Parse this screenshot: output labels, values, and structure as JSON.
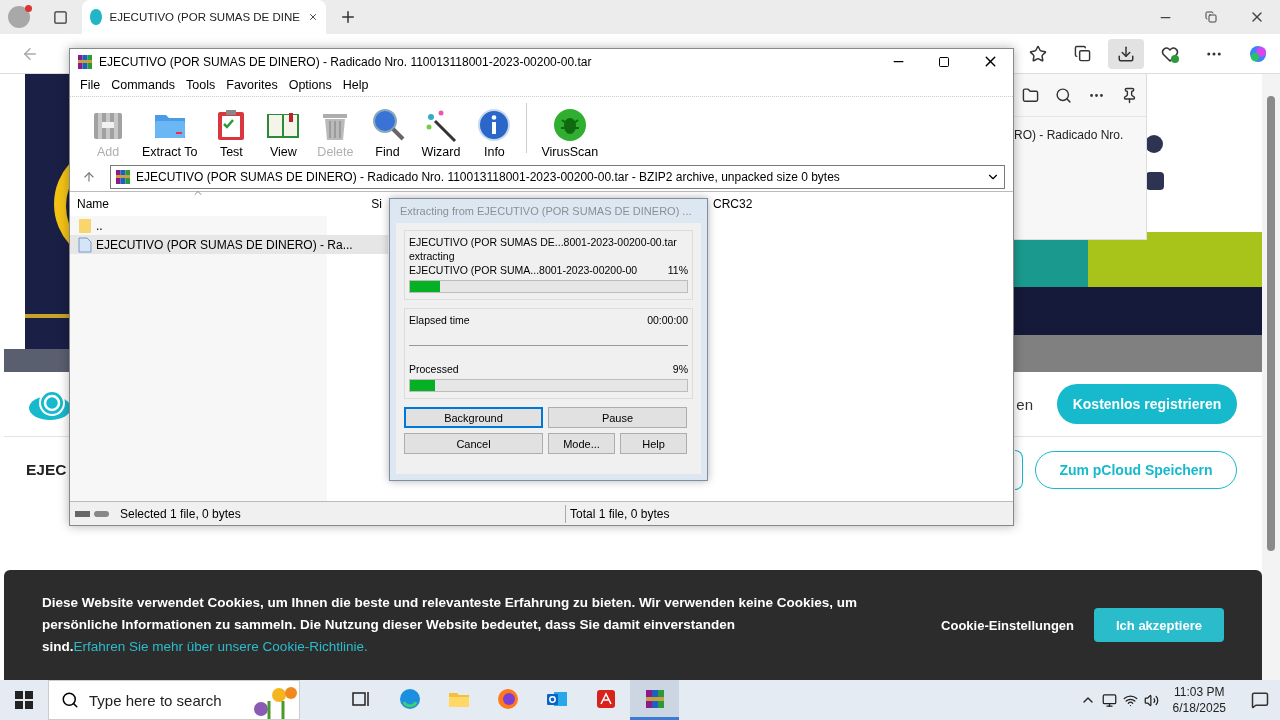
{
  "browser": {
    "tabs": [
      {
        "title": "EJECUTIVO (POR SUMAS DE DINE",
        "selected": true
      }
    ]
  },
  "downloads_panel": {
    "item_text": "RO) - Radicado Nro."
  },
  "page": {
    "register_fragment": "en",
    "register_button": "Kostenlos registrieren",
    "title_fragment": "EJEC",
    "save_button": "Zum pCloud Speichern"
  },
  "cookie_banner": {
    "text": "Diese Website verwendet Cookies, um Ihnen die beste und relevanteste Erfahrung zu bieten. Wir verwenden keine Cookies, um persönliche Informationen zu sammeln. Die Nutzung dieser Website bedeutet, dass Sie damit einverstanden sind.",
    "link": "Erfahren Sie mehr über unsere Cookie-Richtlinie.",
    "settings": "Cookie-Einstellungen",
    "accept": "Ich akzeptiere"
  },
  "winrar": {
    "title": "EJECUTIVO (POR SUMAS DE DINERO) - Radicado Nro. 110013118001-2023-00200-00.tar",
    "menu": [
      "File",
      "Commands",
      "Tools",
      "Favorites",
      "Options",
      "Help"
    ],
    "toolbar": [
      {
        "label": "Add",
        "kind": "add",
        "disabled": true
      },
      {
        "label": "Extract To",
        "kind": "extract",
        "disabled": false
      },
      {
        "label": "Test",
        "kind": "test",
        "disabled": false
      },
      {
        "label": "View",
        "kind": "view",
        "disabled": false
      },
      {
        "label": "Delete",
        "kind": "delete",
        "disabled": true
      },
      {
        "label": "Find",
        "kind": "find",
        "disabled": false
      },
      {
        "label": "Wizard",
        "kind": "wizard",
        "disabled": false
      },
      {
        "label": "Info",
        "kind": "info",
        "disabled": false
      },
      {
        "label": "VirusScan",
        "kind": "virus",
        "disabled": false
      }
    ],
    "address": "EJECUTIVO (POR SUMAS DE DINERO) - Radicado Nro. 110013118001-2023-00200-00.tar - BZIP2 archive, unpacked size 0 bytes",
    "columns": [
      "Name",
      "Si",
      "CRC32"
    ],
    "files": [
      {
        "name": "..",
        "kind": "folder",
        "selected": false
      },
      {
        "name": "EJECUTIVO (POR SUMAS DE DINERO) - Ra...",
        "kind": "file",
        "selected": true
      }
    ],
    "status_left": "Selected 1 file, 0 bytes",
    "status_right": "Total 1 file, 0 bytes"
  },
  "dialog": {
    "title": "Extracting from EJECUTIVO (POR SUMAS DE DINERO) ...",
    "archive": "EJECUTIVO (POR SUMAS DE...8001-2023-00200-00.tar",
    "action": "extracting",
    "file": "EJECUTIVO (POR SUMA...8001-2023-00200-00",
    "file_percent": "11%",
    "file_progress": {
      "level": 0.11
    },
    "elapsed_label": "Elapsed time",
    "elapsed": "00:00:00",
    "processed_label": "Processed",
    "processed_percent": "9%",
    "processed_progress": {
      "level": 0.09
    },
    "buttons": [
      {
        "label": "Background",
        "focused": true
      },
      {
        "label": "Pause",
        "focused": false
      },
      {
        "label": "Cancel",
        "focused": false
      },
      {
        "label": "Mode...",
        "focused": false
      },
      {
        "label": "Help",
        "focused": false
      }
    ]
  },
  "taskbar": {
    "search_placeholder": "Type here to search",
    "apps": [
      {
        "kind": "taskview",
        "active": false
      },
      {
        "kind": "edge",
        "active": false
      },
      {
        "kind": "explorer",
        "active": false
      },
      {
        "kind": "firefox",
        "active": false
      },
      {
        "kind": "outlook",
        "active": false
      },
      {
        "kind": "acrobat",
        "active": false
      },
      {
        "kind": "winrar",
        "active": true
      }
    ],
    "time": "11:03 PM",
    "date": "6/18/2025"
  }
}
